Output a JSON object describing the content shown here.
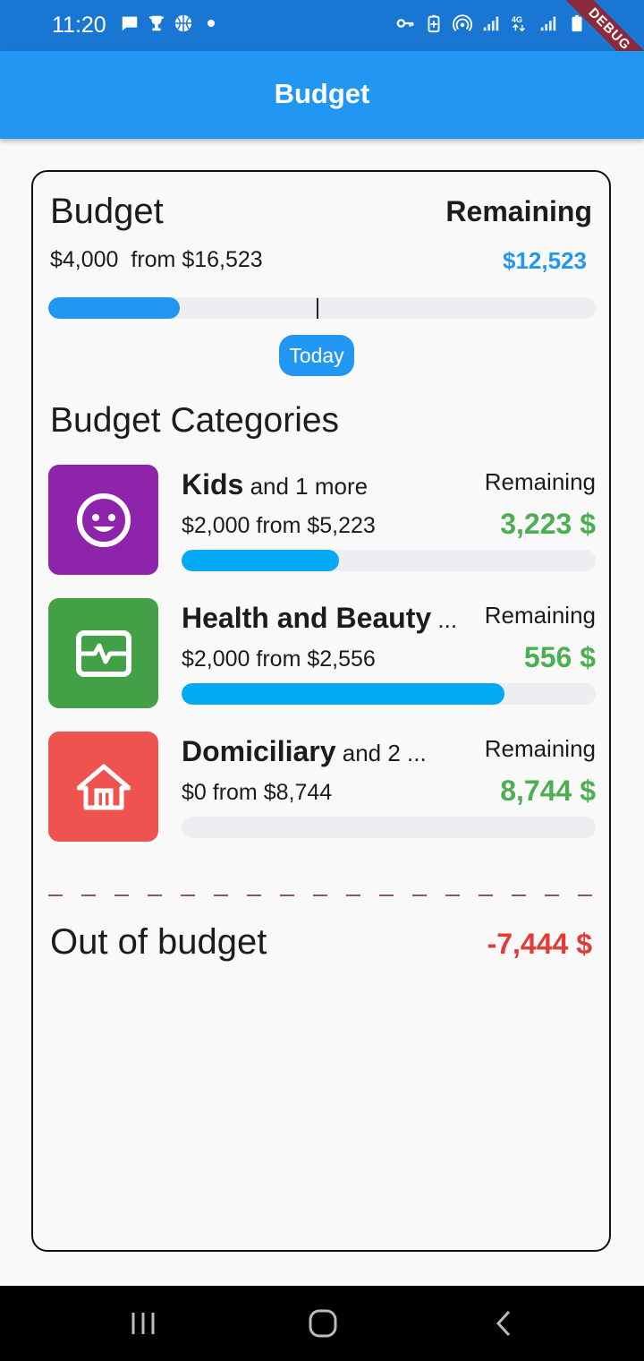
{
  "status_bar": {
    "time": "11:20",
    "debug_label": "DEBUG"
  },
  "app_bar": {
    "title": "Budget"
  },
  "summary": {
    "budget_label": "Budget",
    "remaining_label": "Remaining",
    "spent": "$4,000",
    "from_total": "from $16,523",
    "remaining_value": "$12,523",
    "progress_fraction": 0.24,
    "today_fraction": 0.49,
    "today_label": "Today"
  },
  "categories_title": "Budget Categories",
  "categories": [
    {
      "name": "Kids",
      "more": " and 1 more",
      "remaining_label": "Remaining",
      "amount": "$2,000  from $5,223",
      "remaining_value": "3,223 $",
      "progress_fraction": 0.38,
      "color": "#8e24aa",
      "icon": "baby-face-icon"
    },
    {
      "name": "Health and Beauty",
      "more": " ...",
      "remaining_label": "Remaining",
      "amount": "$2,000  from $2,556",
      "remaining_value": "556 $",
      "progress_fraction": 0.78,
      "color": "#43a047",
      "icon": "heartbeat-monitor-icon"
    },
    {
      "name": "Domiciliary",
      "more": " and 2 ...",
      "remaining_label": "Remaining",
      "amount": "$0  from $8,744",
      "remaining_value": "8,744 $",
      "progress_fraction": 0,
      "color": "#ef5350",
      "icon": "house-icon"
    }
  ],
  "out_of_budget": {
    "label": "Out of budget",
    "value": "-7,444 $"
  },
  "colors": {
    "primary": "#2196f3",
    "status_bar": "#1976d2",
    "positive": "#4caf50",
    "negative": "#e53935",
    "category_bar": "#03a9f4"
  }
}
